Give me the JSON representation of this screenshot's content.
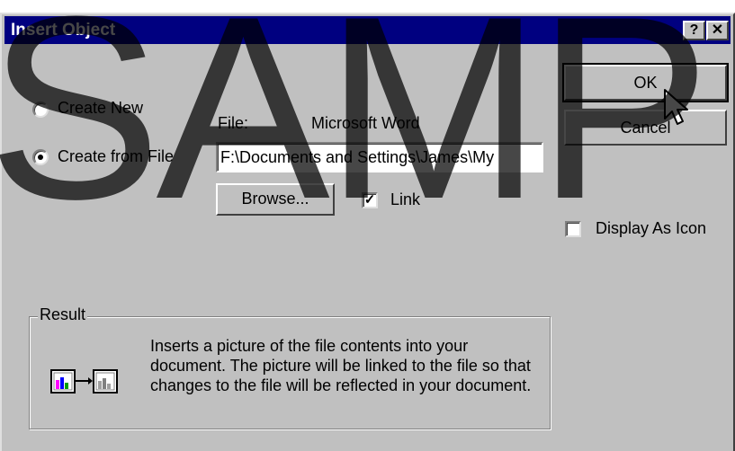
{
  "window": {
    "title": "Insert Object"
  },
  "titlebar": {
    "help_label": "?",
    "close_label": "✕"
  },
  "options": {
    "create_new": "Create New",
    "create_from_file": "Create from File"
  },
  "file": {
    "label": "File:",
    "type": "Microsoft Word",
    "path": "F:\\Documents and Settings\\James\\My"
  },
  "buttons": {
    "ok": "OK",
    "cancel": "Cancel",
    "browse": "Browse..."
  },
  "link": {
    "label": "Link",
    "checked": true
  },
  "display_as_icon": {
    "label": "Display As Icon",
    "checked": false
  },
  "result": {
    "title": "Result",
    "text": "Inserts a picture of the file contents into your document.  The picture will be linked to the file so that changes to the file will be reflected in your document."
  },
  "watermark": "SAMP"
}
